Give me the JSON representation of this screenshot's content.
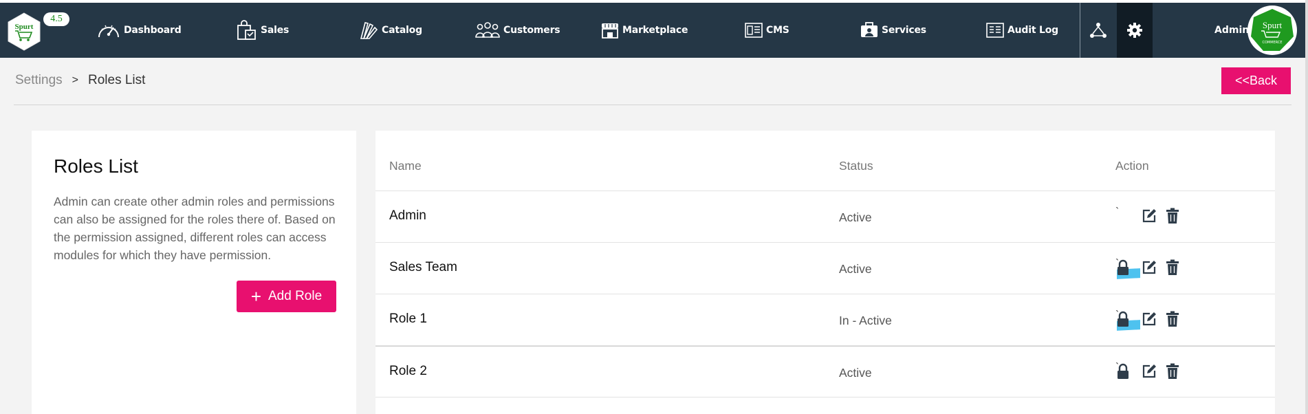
{
  "app": {
    "version": "4.5",
    "logo_text": "Spurt",
    "logo_subtext": "COMMERCE"
  },
  "nav": {
    "items": [
      {
        "label": "Dashboard",
        "icon": "speedometer-icon"
      },
      {
        "label": "Sales",
        "icon": "shopping-bag-icon"
      },
      {
        "label": "Catalog",
        "icon": "catalog-swatch-icon"
      },
      {
        "label": "Customers",
        "icon": "customers-group-icon"
      },
      {
        "label": "Marketplace",
        "icon": "storefront-icon"
      },
      {
        "label": "CMS",
        "icon": "cms-page-icon"
      },
      {
        "label": "Services",
        "icon": "services-briefcase-icon"
      },
      {
        "label": "Audit Log",
        "icon": "audit-log-icon"
      }
    ],
    "user_label": "Admin"
  },
  "breadcrumb": {
    "parent": "Settings",
    "separator": ">",
    "current": "Roles List"
  },
  "back_button": "<<Back",
  "left_panel": {
    "title": "Roles List",
    "description": "Admin can create other admin roles and permissions can also be assigned for the roles there of. Based on the permission assigned, different roles can access modules for which they have permission.",
    "add_button": "Add Role"
  },
  "table": {
    "headers": {
      "name": "Name",
      "status": "Status",
      "action": "Action"
    },
    "rows": [
      {
        "name": "Admin",
        "status": "Active",
        "tick": "`",
        "lock": false,
        "highlight": false
      },
      {
        "name": "Sales Team",
        "status": "Active",
        "tick": "`",
        "lock": true,
        "highlight": true
      },
      {
        "name": "Role 1",
        "status": "In - Active",
        "tick": "`",
        "lock": true,
        "highlight": true
      },
      {
        "name": "Role 2",
        "status": "Active",
        "tick": "`",
        "lock": true,
        "highlight": false
      }
    ]
  },
  "colors": {
    "nav_bg": "#253746",
    "accent": "#e8106f",
    "highlight": "#4ec2ef"
  }
}
